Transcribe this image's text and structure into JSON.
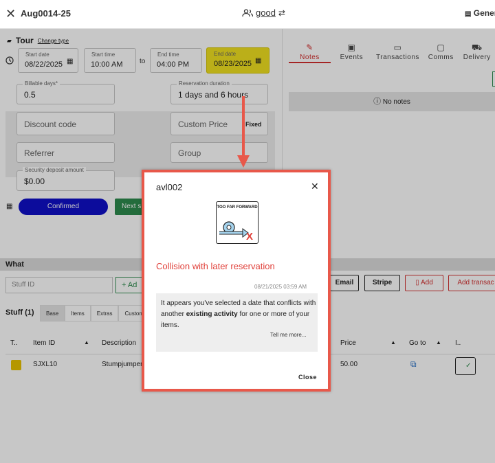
{
  "topbar": {
    "close_icon": "close-icon",
    "title": "Aug0014-25",
    "customer_name": "good",
    "general_label": "Gener"
  },
  "tour": {
    "label": "Tour",
    "change_type": "Change type"
  },
  "dates": {
    "start_date_label": "Start date",
    "start_date": "08/22/2025",
    "start_time_label": "Start time",
    "start_time": "10:00 AM",
    "to_label": "to",
    "end_time_label": "End time",
    "end_time": "04:00 PM",
    "end_date_label": "End date",
    "end_date": "08/23/2025"
  },
  "form": {
    "billable_days_label": "Billable days*",
    "billable_days": "0.5",
    "reservation_duration_label": "Reservation duration",
    "reservation_duration": "1 days and 6 hours",
    "discount_code_placeholder": "Discount code",
    "custom_price_placeholder": "Custom Price",
    "fixed_label": "Fixed",
    "referrer_placeholder": "Referrer",
    "group_placeholder": "Group",
    "security_deposit_label": "Security deposit amount",
    "security_deposit": "$0.00"
  },
  "status": {
    "confirmed_label": "Confirmed",
    "next_label": "Next s"
  },
  "right_tabs": [
    {
      "label": "Notes",
      "icon": "notes-icon"
    },
    {
      "label": "Events",
      "icon": "events-icon"
    },
    {
      "label": "Transactions",
      "icon": "transactions-icon"
    },
    {
      "label": "Comms",
      "icon": "comms-icon"
    },
    {
      "label": "Delivery",
      "icon": "delivery-icon"
    }
  ],
  "no_notes": "No notes",
  "what": {
    "label": "What",
    "stuff_id_placeholder": "Stuff ID",
    "add_label": "+ Ad",
    "email_label": "Email",
    "stripe_label": "Stripe",
    "add_red_label": "Add",
    "add_transaction_label": "Add transac"
  },
  "stuff": {
    "title": "Stuff (1)",
    "tabs": [
      "Base",
      "Items",
      "Extras",
      "Customer"
    ],
    "columns": [
      "T..",
      "Item ID",
      "Description",
      "Price",
      "Go to",
      "I.."
    ],
    "rows": [
      {
        "item_id": "SJXL10",
        "description": "Stumpjumper",
        "price": "50.00"
      }
    ]
  },
  "modal": {
    "title": "avl002",
    "illustration_text": "TOO FAR FORWARD",
    "heading": "Collision with later reservation",
    "timestamp": "08/21/2025 03:59 AM",
    "message_pre": "It appears you've selected a date that conflicts with another ",
    "message_bold": "existing activity",
    "message_post": " for one or more of your items.",
    "tell_more": "Tell me more...",
    "close_label": "Close"
  },
  "colors": {
    "accent_red": "#e0403a",
    "confirmed_blue": "#1010c8",
    "highlight_yellow": "#f0e020",
    "green": "#2e8b4e"
  }
}
